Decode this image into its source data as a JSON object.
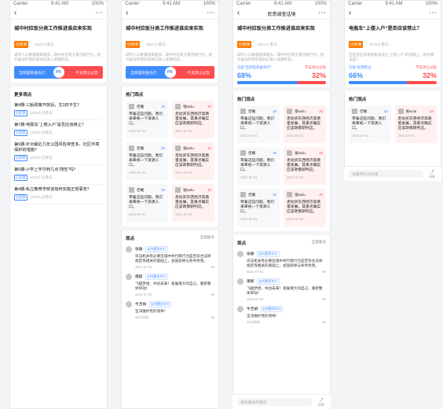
{
  "screens": [
    {
      "status": {
        "left": "Carrier",
        "center": "9:41 AM",
        "right": "100%"
      },
      "nav_title": "",
      "question": {
        "title": "城中村拉饭分类工作推进谁应来实现",
        "tag": "已结束",
        "meta": "2021人参与",
        "desc": "城市人口数量越来越多，城中村出现大量违规行为，提升居住环境的规划已进入关键阶段。",
        "vs_left": "当然是资金先行",
        "vs_pk": "PK",
        "vs_right": "不支持之过急"
      },
      "more_title": "更多观点",
      "more_items": [
        {
          "title": "第4期-三胎政策开放后，生3孩不生？",
          "tag": "已结束",
          "meta": "1075人已参与"
        },
        {
          "title": "第7期-电瓶车“上楼入户”是否应该禁止？",
          "tag": "已结束",
          "meta": "1075人已参与"
        },
        {
          "title": "第6期-针对最近几年公园风险排查多，社区环境保护的措施？",
          "tag": "已结束",
          "meta": "1075人已参与"
        },
        {
          "title": "第5期-小学上学牙到几点“刚性”吗？",
          "tag": "已结束",
          "meta": "1075人已参与"
        },
        {
          "title": "第4期-私立教育学校该如何实施正规事务？",
          "tag": "已结束",
          "meta": "1075人已参与"
        }
      ]
    },
    {
      "status": {
        "left": "Carrier",
        "center": "9:41 AM",
        "right": "100%"
      },
      "nav_title": "",
      "question": {
        "title": "城中村拉饭分类工作推进谁应来实现",
        "tag": "已结束",
        "meta": "2021人参与",
        "desc": "城市人口数量越来越多，城中村出现大量违规行为，提升居住环境的规划已进入关键阶段。",
        "vs_left": "当然是资金先行",
        "vs_pk": "PK",
        "vs_right": "不支持之过急"
      },
      "hot_title": "热门观点",
      "cards": [
        {
          "name": "佳曦",
          "likes": "30",
          "text": "带着这些问题，我们来审视一下资源人口。",
          "date": "2021-07-01",
          "side": "blue"
        },
        {
          "name": "张luclu",
          "likes": "20",
          "text": "走动买东西经济高质量发展，其重点确实应该政策研判这。",
          "date": "2021-07-01",
          "side": "red"
        },
        {
          "name": "佳曦",
          "likes": "30",
          "text": "带着这些问题，我们来审视一下资源人口。",
          "date": "2021-07-01",
          "side": "blue"
        },
        {
          "name": "张luclu",
          "likes": "20",
          "text": "走动买东西经济高质量发展，其重点确实应该政策研判这。",
          "date": "2021-07-01",
          "side": "red"
        },
        {
          "name": "佳曦",
          "likes": "30",
          "text": "带着这些问题，我们来审视一下资源人口。",
          "date": "2021-07-01",
          "side": "blue"
        },
        {
          "name": "张luclu",
          "likes": "20",
          "text": "走动买东西经济高质量发展，其重点确实应该政策研判这。",
          "date": "2021-07-01",
          "side": "red"
        }
      ],
      "comments_title": "观点",
      "comments_sort": "全部观点",
      "comments": [
        {
          "name": "张静",
          "tag": "支持置资先行",
          "text": "司法机关有必要在城中村行政行为是否符合法律规定等相关的基础上，加强指导与条件改善。",
          "date": "2021-07-01",
          "likes": "99"
        },
        {
          "name": "康毅",
          "tag": "支持置资先行",
          "text": "飞越梦想，共创未来！发展增大的自己。重新整体带动！",
          "date": "2021-07-02",
          "likes": "99"
        },
        {
          "name": "牛吉娟",
          "tag": "支持置资先行",
          "text": "坚决维护党的领导！",
          "date": "40分钟前",
          "likes": "99"
        }
      ]
    },
    {
      "status": {
        "left": "Carrier",
        "center": "9:41 AM",
        "right": "100%"
      },
      "nav_title": "民意调查话境",
      "question": {
        "title": "城中村拉饭分类工作推进谁应来实现",
        "tag": "已结束",
        "meta": "2021人参与",
        "desc": "城市人口数量越来越多，城中村出现大量违规行为，提升居住环境的规划已进入关键阶段。",
        "poll_left_label": "已投“当然是资金先行”",
        "poll_right_label": "不支持之过急",
        "poll_left_pct": "68%",
        "poll_right_pct": "32%",
        "poll_fill": 0.68
      },
      "hot_title": "热门观点",
      "cards": [
        {
          "name": "佳曦",
          "likes": "30",
          "text": "带着这些问题，我们来审视一下资源人口。",
          "date": "2021-07-01",
          "side": "blue"
        },
        {
          "name": "张luclu",
          "likes": "20",
          "text": "走动买东西经济高质量发展，其重点确实应该政策研判这。",
          "date": "2021-07-01",
          "side": "red"
        },
        {
          "name": "佳曦",
          "likes": "30",
          "text": "带着这些问题，我们来审视一下资源人口。",
          "date": "2021-07-01",
          "side": "blue"
        },
        {
          "name": "张luclu",
          "likes": "20",
          "text": "走动买东西经济高质量发展，其重点确实应该政策研判这。",
          "date": "2021-07-01",
          "side": "red"
        },
        {
          "name": "佳曦",
          "likes": "30",
          "text": "带着这些问题，我们来审视一下资源人口。",
          "date": "2021-07-01",
          "side": "blue"
        },
        {
          "name": "张luclu",
          "likes": "20",
          "text": "走动买东西经济高质量发展，其重点确实应该政策研判这。",
          "date": "2021-07-01",
          "side": "red"
        }
      ],
      "comments_title": "观点",
      "comments_sort": "全部观点",
      "comments": [
        {
          "name": "张静",
          "tag": "支持置资先行",
          "text": "司法机关有必要在城中村行政行为是否符合法律规定等相关的基础上，加强指导与条件改善。",
          "date": "2021-07-01",
          "likes": "99"
        },
        {
          "name": "康毅",
          "tag": "支持置资先行",
          "text": "飞越梦想，共创未来！发展增大的自己。重新整体带动！",
          "date": "2021-07-02",
          "likes": "99"
        },
        {
          "name": "牛吉娟",
          "tag": "支持置资先行",
          "text": "坚决维护党的领导！",
          "date": "40分钟前",
          "likes": "99"
        }
      ],
      "input_placeholder": "请发表你的观点",
      "share_label": "分享"
    },
    {
      "status": {
        "left": "Carrier",
        "center": "9:41 AM",
        "right": "100%"
      },
      "nav_title": "",
      "question": {
        "title": "电瓶车“上楼入户”是否应该禁止？",
        "tag": "已结束",
        "meta": "1075人参与",
        "desc": "在是否应该将电瓶车禁止“上楼入户”的问题上，你的看法是？",
        "poll_left_label": "已投“支持禁止”",
        "poll_right_label": "不支持之过急",
        "poll_left_pct": "66%",
        "poll_right_pct": "32%",
        "poll_fill": 0.66
      },
      "hot_title": "热门观点",
      "cards": [
        {
          "name": "佳曦",
          "likes": "30",
          "text": "带着这些问题，我们来审视一下资源人口。",
          "date": "2021-07-01",
          "side": "blue"
        },
        {
          "name": "张luclu",
          "likes": "20",
          "text": "走动买东西经济高质量发展，其重点确实应该政策研判这。",
          "date": "2021-07-01",
          "side": "red"
        }
      ],
      "input_placeholder": "本期评论已结束",
      "share_label": "分享"
    }
  ]
}
